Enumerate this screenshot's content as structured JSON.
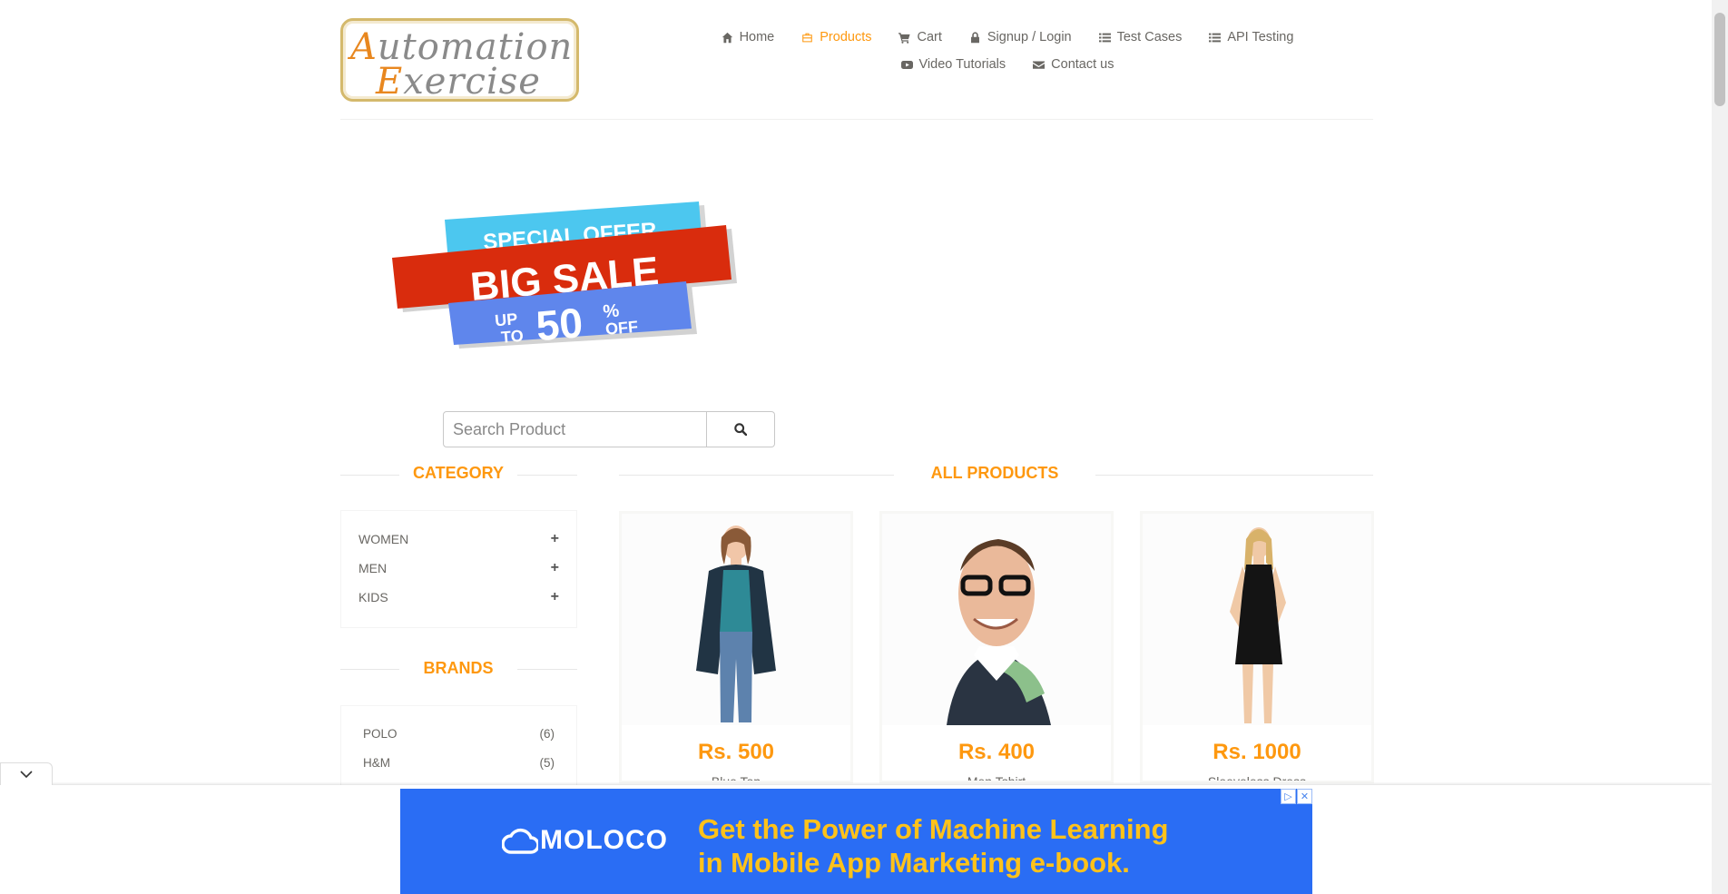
{
  "logo": {
    "line1": "utomation",
    "line1_cap": "A",
    "line2": "xercise",
    "line2_cap": "E"
  },
  "nav": {
    "home": "Home",
    "products": "Products",
    "cart": "Cart",
    "signup_login": "Signup / Login",
    "test_cases": "Test Cases",
    "api_testing": "API Testing",
    "video_tutorials": "Video Tutorials",
    "contact_us": "Contact us",
    "active": "Products"
  },
  "banner": {
    "line1": "SPECIAL OFFER",
    "line2": "BIG SALE",
    "up": "UP",
    "to": "TO",
    "percent": "50",
    "pct_sign": "%",
    "off": "OFF"
  },
  "search": {
    "placeholder": "Search Product"
  },
  "sidebar": {
    "category_title": "CATEGORY",
    "categories": [
      {
        "label": "WOMEN",
        "icon": "+"
      },
      {
        "label": "MEN",
        "icon": "+"
      },
      {
        "label": "KIDS",
        "icon": "+"
      }
    ],
    "brands_title": "BRANDS",
    "brands": [
      {
        "label": "POLO",
        "count": "(6)"
      },
      {
        "label": "H&M",
        "count": "(5)"
      }
    ]
  },
  "main": {
    "title": "ALL PRODUCTS",
    "products": [
      {
        "price": "Rs. 500",
        "name": "Blue Top"
      },
      {
        "price": "Rs. 400",
        "name": "Men Tshirt"
      },
      {
        "price": "Rs. 1000",
        "name": "Sleeveless Dress"
      }
    ]
  },
  "ad": {
    "brand": "MOLOCO",
    "line1": "Get the Power of Machine Learning",
    "line2": "in Mobile App Marketing e-book.",
    "close": "✕",
    "adchoices": "▷"
  },
  "colors": {
    "accent": "#FE980F",
    "text": "#696763",
    "ad_bg": "#2a6df4",
    "ad_text": "#ffc21a"
  }
}
